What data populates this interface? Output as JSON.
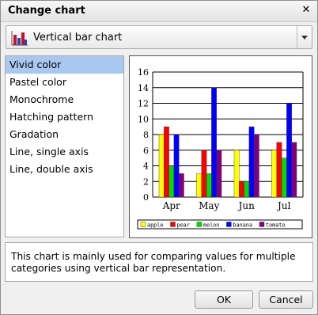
{
  "dialog": {
    "title": "Change chart",
    "close_icon": "close-icon"
  },
  "chart_type_select": {
    "selected_label": "Vertical bar chart",
    "icon": "vertical-bar-chart-icon"
  },
  "styles": {
    "items": [
      {
        "label": "Vivid color",
        "selected": true
      },
      {
        "label": "Pastel color",
        "selected": false
      },
      {
        "label": "Monochrome",
        "selected": false
      },
      {
        "label": "Hatching pattern",
        "selected": false
      },
      {
        "label": "Gradation",
        "selected": false
      },
      {
        "label": "Line, single axis",
        "selected": false
      },
      {
        "label": "Line, double axis",
        "selected": false
      }
    ],
    "selected_color": "#a9c8f0"
  },
  "chart_data": {
    "type": "bar",
    "categories": [
      "Apr",
      "May",
      "Jun",
      "Jul"
    ],
    "series": [
      {
        "name": "apple",
        "color": "#ffff00",
        "values": [
          8,
          3,
          6,
          6
        ]
      },
      {
        "name": "pear",
        "color": "#ff0000",
        "values": [
          9,
          6,
          2,
          7
        ]
      },
      {
        "name": "melon",
        "color": "#00e000",
        "values": [
          4,
          3,
          2,
          5
        ]
      },
      {
        "name": "banana",
        "color": "#0000ff",
        "values": [
          8,
          14,
          9,
          12
        ]
      },
      {
        "name": "tomato",
        "color": "#800080",
        "values": [
          3,
          6,
          8,
          7
        ]
      }
    ],
    "yticks": [
      0,
      2,
      4,
      6,
      8,
      10,
      12,
      14,
      16
    ],
    "ylim": [
      0,
      16
    ],
    "grid": true,
    "legend_position": "bottom"
  },
  "description": {
    "text": "This chart is mainly used for comparing values for multiple categories using vertical bar representation."
  },
  "buttons": {
    "ok": "OK",
    "cancel": "Cancel"
  }
}
